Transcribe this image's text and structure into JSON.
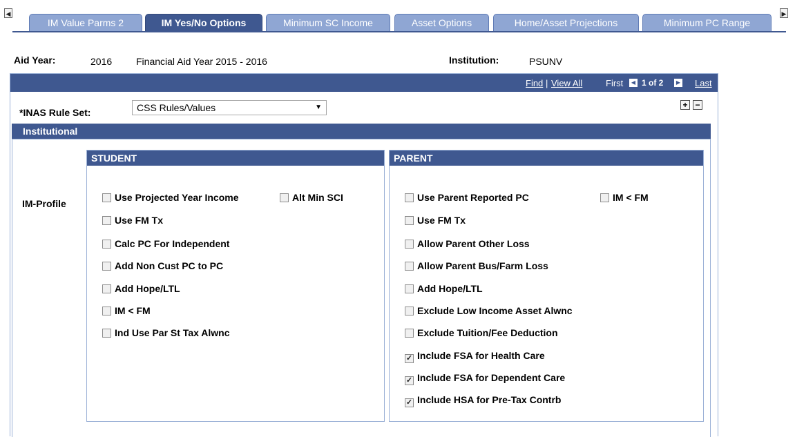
{
  "tabs": [
    {
      "label": "IM Value Parms 2",
      "active": false
    },
    {
      "label": "IM Yes/No Options",
      "active": true
    },
    {
      "label": "Minimum SC Income",
      "active": false
    },
    {
      "label": "Asset Options",
      "active": false
    },
    {
      "label": "Home/Asset Projections",
      "active": false
    },
    {
      "label": "Minimum PC Range",
      "active": false
    }
  ],
  "header": {
    "aid_year_label": "Aid Year:",
    "aid_year_value": "2016",
    "aid_year_desc": "Financial Aid Year 2015 - 2016",
    "institution_label": "Institution:",
    "institution_value": "PSUNV"
  },
  "nav": {
    "find": "Find",
    "sep": "|",
    "view_all": "View All",
    "first": "First",
    "position": "1 of 2",
    "last": "Last"
  },
  "rule_set": {
    "label": "*INAS Rule Set:",
    "value": "CSS Rules/Values"
  },
  "group_title": "Institutional",
  "profile_label": "IM-Profile",
  "student": {
    "title": "STUDENT",
    "options": [
      {
        "label": "Use Projected Year Income",
        "checked": false
      },
      {
        "label": "Alt Min SCI",
        "checked": false
      },
      {
        "label": "Use FM Tx",
        "checked": false
      },
      {
        "label": "Calc PC For Independent",
        "checked": false
      },
      {
        "label": "Add Non Cust PC to PC",
        "checked": false
      },
      {
        "label": "Add Hope/LTL",
        "checked": false
      },
      {
        "label": "IM < FM",
        "checked": false
      },
      {
        "label": "Ind Use Par St Tax Alwnc",
        "checked": false
      }
    ]
  },
  "parent": {
    "title": "PARENT",
    "options": [
      {
        "label": "Use Parent Reported PC",
        "checked": false
      },
      {
        "label": "IM < FM",
        "checked": false
      },
      {
        "label": "Use FM Tx",
        "checked": false
      },
      {
        "label": "Allow Parent Other Loss",
        "checked": false
      },
      {
        "label": "Allow Parent Bus/Farm Loss",
        "checked": false
      },
      {
        "label": "Add Hope/LTL",
        "checked": false
      },
      {
        "label": "Exclude Low Income Asset Alwnc",
        "checked": false
      },
      {
        "label": "Exclude Tuition/Fee Deduction",
        "checked": false
      },
      {
        "label": "Include FSA for Health Care",
        "checked": true
      },
      {
        "label": "Include FSA for Dependent Care",
        "checked": true
      },
      {
        "label": "Include HSA for Pre-Tax Contrb",
        "checked": true
      }
    ]
  }
}
